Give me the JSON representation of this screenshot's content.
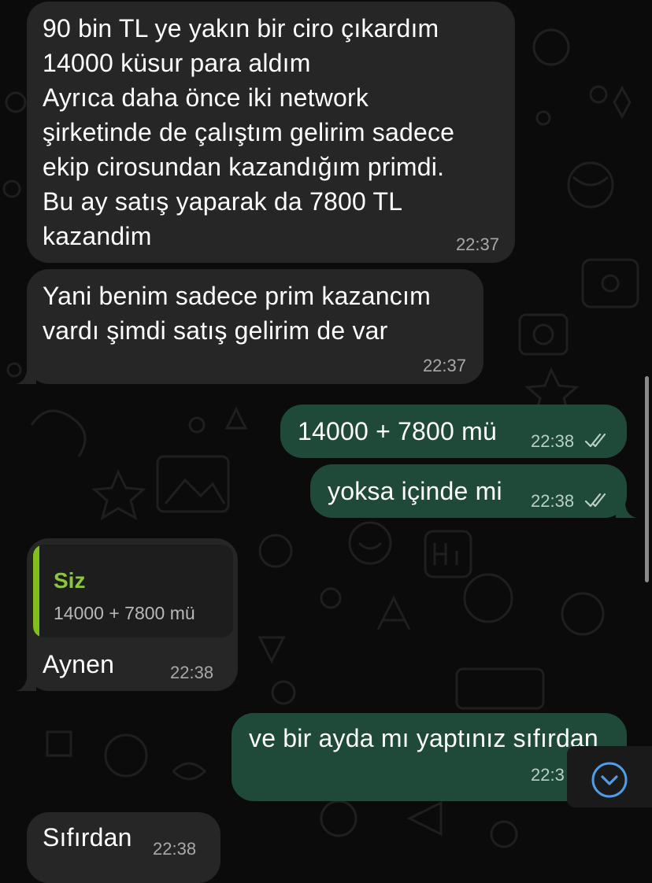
{
  "messages": [
    {
      "id": "m1",
      "direction": "incoming",
      "text": "90 bin TL ye yakın bir ciro çıkardım\n14000 küsur para aldım\nAyrıca daha önce iki network\nşirketinde de çalıştım gelirim sadece\nekip cirosundan kazandığım primdi.\nBu ay satış yaparak da 7800 TL\nkazandim",
      "time": "22:37"
    },
    {
      "id": "m2",
      "direction": "incoming",
      "text": "Yani benim sadece prim kazancım\nvardı şimdi satış gelirim de var",
      "time": "22:37"
    },
    {
      "id": "m3",
      "direction": "outgoing",
      "text": "14000 + 7800 mü",
      "time": "22:38",
      "status": "read"
    },
    {
      "id": "m4",
      "direction": "outgoing",
      "text": "yoksa içinde mi",
      "time": "22:38",
      "status": "read"
    },
    {
      "id": "m5",
      "direction": "incoming",
      "text": "Aynen",
      "time": "22:38",
      "reply": {
        "author": "Siz",
        "text": "14000 + 7800 mü"
      }
    },
    {
      "id": "m6",
      "direction": "outgoing",
      "text": "ve bir ayda mı yaptınız sıfırdan",
      "time": "22:3"
    },
    {
      "id": "m7",
      "direction": "incoming",
      "text": "Sıfırdan",
      "time": "22:38"
    }
  ],
  "icons": {
    "read_receipt": "double-check-icon",
    "scroll_down": "chevron-down-icon"
  },
  "colors": {
    "background": "#0b0b0b",
    "incoming_bubble": "#262626",
    "outgoing_bubble": "#1f4a3a",
    "quote_accent": "#7fbf1f",
    "scroll_accent": "#4f9de8"
  }
}
